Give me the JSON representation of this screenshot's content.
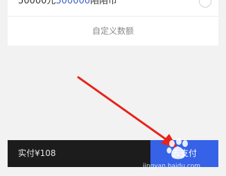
{
  "package_option": {
    "amount_text": "50000元",
    "bonus_text": "500000",
    "currency_text": "陌陌币"
  },
  "custom_amount_label": "自定义数额",
  "bottom_bar": {
    "paid_label": "实付¥108",
    "pay_button_label": "去支付"
  },
  "watermark": {
    "text": "jingyan.baidu.com",
    "logo_text": "Bai经验"
  },
  "colors": {
    "accent_blue": "#3562e6",
    "highlight_blue": "#3a5fc8",
    "annotation_red": "#e8231b",
    "bar_dark": "#1c1c1c"
  }
}
